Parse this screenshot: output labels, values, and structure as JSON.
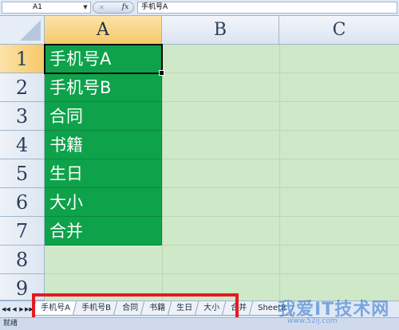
{
  "formula_bar": {
    "name_box": "A1",
    "fx_symbol": "fx",
    "cancel_symbol": "✕",
    "formula": "手机号A"
  },
  "columns": [
    "A",
    "B",
    "C"
  ],
  "rows": [
    "1",
    "2",
    "3",
    "4",
    "5",
    "6",
    "7",
    "8",
    "9"
  ],
  "cells": [
    "手机号A",
    "手机号B",
    "合同",
    "书籍",
    "生日",
    "大小",
    "合并"
  ],
  "sheet_tabs": [
    "手机号A",
    "手机号B",
    "合同",
    "书籍",
    "生日",
    "大小",
    "合并",
    "Sheet8"
  ],
  "active_tab_index": 0,
  "status": {
    "text": "就绪"
  },
  "watermark": {
    "text": "我爱IT技术网",
    "url": "www.52ij.com"
  },
  "colors": {
    "cell_fill": "#0ea24a",
    "sheet_background": "#cfe9c8",
    "highlight_box": "#e41b23"
  },
  "icons": {
    "nav_first": "◀◀",
    "nav_prev": "◀",
    "nav_next": "▶",
    "nav_last": "▶▶",
    "dropdown": "▼"
  }
}
